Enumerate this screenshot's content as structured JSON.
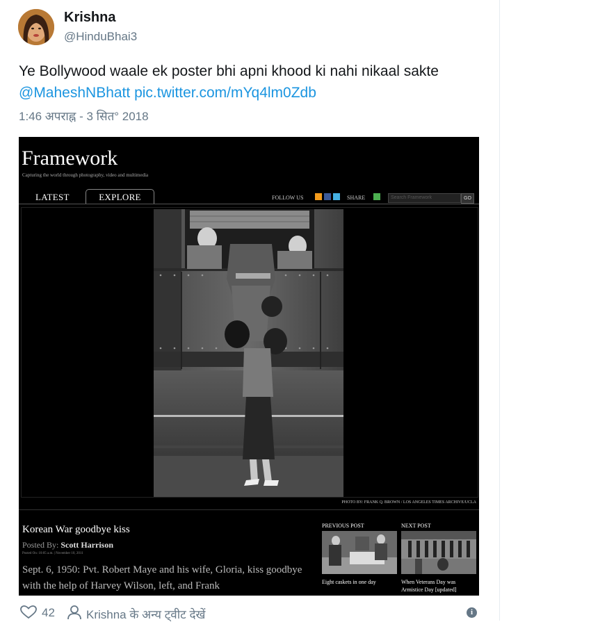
{
  "user": {
    "name": "Krishna",
    "handle": "@HinduBhai3"
  },
  "tweet": {
    "text": "Ye Bollywood waale ek poster bhi apni khood ki nahi nikaal sakte",
    "mention": "@MaheshNBhatt",
    "link": "pic.twitter.com/mYq4lm0Zdb",
    "timestamp": "1:46 अपराह्न - 3 सित° 2018"
  },
  "media": {
    "site_title": "Framework",
    "site_subtitle": "Capturing the world through photography, video and multimedia",
    "nav": {
      "latest": "LATEST",
      "explore": "EXPLORE",
      "follow_us": "FOLLOW US",
      "share": "SHARE",
      "search_placeholder": "Search Framework",
      "go": "GO"
    },
    "photo_credit": "PHOTO BY: FRANK Q. BROWN / LOS ANGELES TIMES ARCHIVE/UCLA",
    "post_title": "Korean War goodbye kiss",
    "posted_by_label": "Posted By:",
    "posted_by": "Scott Harrison",
    "posted_on": "Posted On: 10:05 a.m. | November 10, 2011",
    "caption": "Sept. 6, 1950: Pvt. Robert Maye and his wife, Gloria, kiss goodbye with the help of Harvey Wilson, left, and Frank",
    "prev_label": "PREVIOUS POST",
    "next_label": "NEXT POST",
    "prev_caption": "Eight caskets in one day",
    "next_caption": "When Veterans Day was Armistice Day [updated]"
  },
  "footer": {
    "likes": "42",
    "more_tweets": "Krishna के अन्य ट्वीट देखें",
    "info": "i"
  },
  "colors": {
    "link": "#1b95e0",
    "secondary": "#657786"
  }
}
